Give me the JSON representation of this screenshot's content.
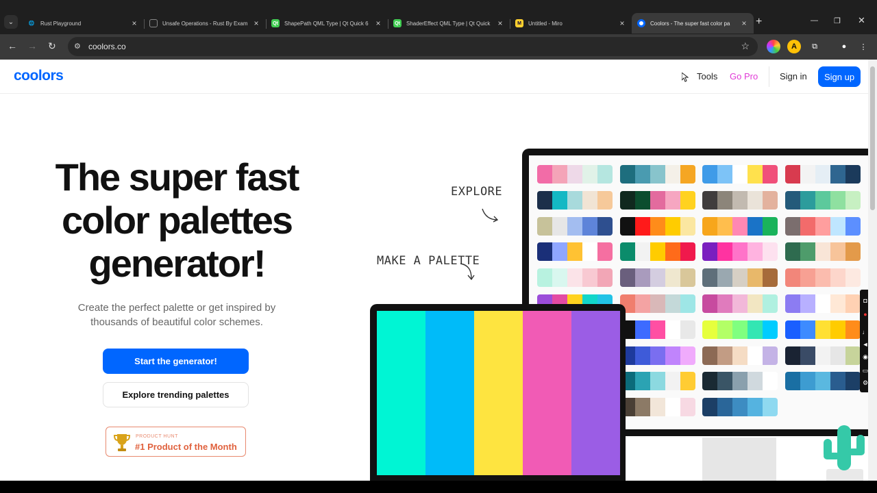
{
  "browser": {
    "tabs": [
      {
        "title": "Rust Playground",
        "favicon": "globe-icon",
        "active": false
      },
      {
        "title": "Unsafe Operations - Rust By Exam",
        "favicon": "book-icon",
        "active": false
      },
      {
        "title": "ShapePath QML Type | Qt Quick 6",
        "favicon": "qt-icon",
        "favicon_text": "Qt",
        "active": false
      },
      {
        "title": "ShaderEffect QML Type | Qt Quick",
        "favicon": "qt-icon",
        "favicon_text": "Qt",
        "active": false
      },
      {
        "title": "Untitled - Miro",
        "favicon": "miro-icon",
        "favicon_text": "M",
        "active": false
      },
      {
        "title": "Coolors - The super fast color pa",
        "favicon": "coolors-icon",
        "active": true
      }
    ],
    "url": "coolors.co"
  },
  "header": {
    "logo": "coolors",
    "nav": {
      "tools": "Tools",
      "go_pro": "Go Pro",
      "sign_in": "Sign in",
      "sign_up": "Sign up"
    }
  },
  "hero": {
    "title_lines": [
      "The super fast",
      "color palettes",
      "generator!"
    ],
    "subtitle_lines": [
      "Create the perfect palette or get inspired by",
      "thousands of beautiful color schemes."
    ],
    "primary_button": "Start the generator!",
    "secondary_button": "Explore trending palettes",
    "badge": {
      "label": "PRODUCT HUNT",
      "text": "#1 Product of the Month"
    }
  },
  "illustration": {
    "annotations": {
      "explore": "EXPLORE",
      "make_palette": "MAKE A PALETTE"
    },
    "laptop_palette": [
      "#00f5d4",
      "#00bbf9",
      "#fee440",
      "#f15bb5",
      "#9b5de5"
    ],
    "monitor_palettes": [
      [
        "#f26ca7",
        "#f4a4b8",
        "#eed9e8",
        "#e1f2e8",
        "#b5e6e0"
      ],
      [
        "#1e6e7e",
        "#4a9bb0",
        "#88c4cc",
        "#f4f0e8",
        "#f5a623"
      ],
      [
        "#3f9be8",
        "#7dc3f7",
        "#ffffff",
        "#ffe14d",
        "#f0507a"
      ],
      [
        "#d83b4f",
        "#f3f3f3",
        "#e5eef5",
        "#2f6690",
        "#1b3a5b"
      ],
      [
        "#1c2f4a",
        "#14b8c4",
        "#a8dadc",
        "#f1e4d4",
        "#f6c99a"
      ],
      [
        "#10291e",
        "#0b4d2e",
        "#e36b9e",
        "#f6a6c1",
        "#ffd21f"
      ],
      [
        "#403d3d",
        "#8c857a",
        "#c2bab0",
        "#eae3d9",
        "#e3b29e"
      ],
      [
        "#245a7a",
        "#2c9c9c",
        "#5cc99c",
        "#8fe0a0",
        "#c7f0c2"
      ],
      [
        "#c7c29a",
        "#e6e6e6",
        "#a3bdf0",
        "#5e84d9",
        "#2e4f8f"
      ],
      [
        "#111111",
        "#ff1a1a",
        "#ff8c1a",
        "#ffcc00",
        "#fbe7a1"
      ],
      [
        "#f7a61b",
        "#ffbe4d",
        "#ff88b3",
        "#1a73c7",
        "#1ab35b"
      ],
      [
        "#7b6e6e",
        "#f26b6b",
        "#ff9e9e",
        "#bfe6ff",
        "#5c8fff"
      ],
      [
        "#1a2f78",
        "#8fa6ff",
        "#ffc233",
        "#ffffff",
        "#f56fa1"
      ],
      [
        "#0b8c6b",
        "#f2f2f2",
        "#ffcc00",
        "#ff6b1a",
        "#f0194c"
      ],
      [
        "#7a1fbf",
        "#ff33a1",
        "#ff73c9",
        "#ffb3e0",
        "#fde1ef"
      ],
      [
        "#2e6b4f",
        "#4e9c6b",
        "#f9e5d7",
        "#f7c49a",
        "#e39a4a"
      ],
      [
        "#b8f2e0",
        "#d9f7ef",
        "#fbe3e8",
        "#f8c9d2",
        "#f2a6b6"
      ],
      [
        "#6a5f7d",
        "#a99bbd",
        "#d4cde0",
        "#efe7cf",
        "#d9c79a"
      ],
      [
        "#5f6f7a",
        "#9aa8b0",
        "#d6cfc4",
        "#e8b86a",
        "#a66b3a"
      ],
      [
        "#f2867a",
        "#f7a093",
        "#fbbcae",
        "#fdd6cb",
        "#fde9e1"
      ],
      [
        "#9b4dd9",
        "#e34ba3",
        "#ffd21f",
        "#12d6c9",
        "#22c3e6"
      ],
      [
        "#f07e6e",
        "#f4a3a3",
        "#d9b8b8",
        "#c4d9d9",
        "#9ee6e6"
      ],
      [
        "#c74b9f",
        "#e07bbd",
        "#f2b8d9",
        "#f2e6c2",
        "#b0f0e0"
      ],
      [
        "#8c7cf2",
        "#b8b0ff",
        "#ffffff",
        "#ffe8d6",
        "#ffd1b3"
      ],
      [
        "#f7a21b",
        "#ffd500",
        "#6bbf3a",
        "#2e8b2e",
        "#1a4d1a"
      ],
      [
        "#111111",
        "#3d6bff",
        "#ff4fa3",
        "#ffffff",
        "#e8e8e8"
      ],
      [
        "#e6ff3d",
        "#b3ff66",
        "#80ff80",
        "#33e6b3",
        "#00ccff"
      ],
      [
        "#1a5fff",
        "#3d8bff",
        "#ffe033",
        "#ffcc00",
        "#ff8c1a"
      ],
      [
        "#8b5cf6",
        "#c084fc",
        "#e879f9",
        "#5eead4",
        "#bef264"
      ],
      [
        "#1e3a9c",
        "#3e5bd9",
        "#7a6ef0",
        "#c084fc",
        "#f0abfc"
      ],
      [
        "#8c6a55",
        "#c29c84",
        "#f5dcc4",
        "#ffffff",
        "#c4b3e6"
      ],
      [
        "#1a2333",
        "#3a4b66",
        "#f2f2f2",
        "#e6e6e6",
        "#c7d49b"
      ],
      [
        "#ff4d94",
        "#f067b0",
        "#d16ad9",
        "#a86ee0",
        "#7d73e6"
      ],
      [
        "#0b6b7a",
        "#2ba3b3",
        "#8cd9e0",
        "#f2f2f2",
        "#ffcc33"
      ],
      [
        "#1a2a33",
        "#3a5566",
        "#8aa0ad",
        "#d0d9de",
        "#ffffff"
      ],
      [
        "#1a6fa3",
        "#3d9cd1",
        "#5ab8e0",
        "#2a5d8f",
        "#1c3f66"
      ],
      [
        "#0b4d2e",
        "#ffffff",
        "#ffe6f0",
        "#ffcce0",
        "#ffb3d1"
      ],
      [
        "#4a3f35",
        "#8c7a66",
        "#f2e6d9",
        "#ffffff",
        "#f7d9e3"
      ],
      [
        "#1c3f66",
        "#2a6699",
        "#3d8cc2",
        "#55b3e0",
        "#8fd9f0"
      ]
    ]
  }
}
